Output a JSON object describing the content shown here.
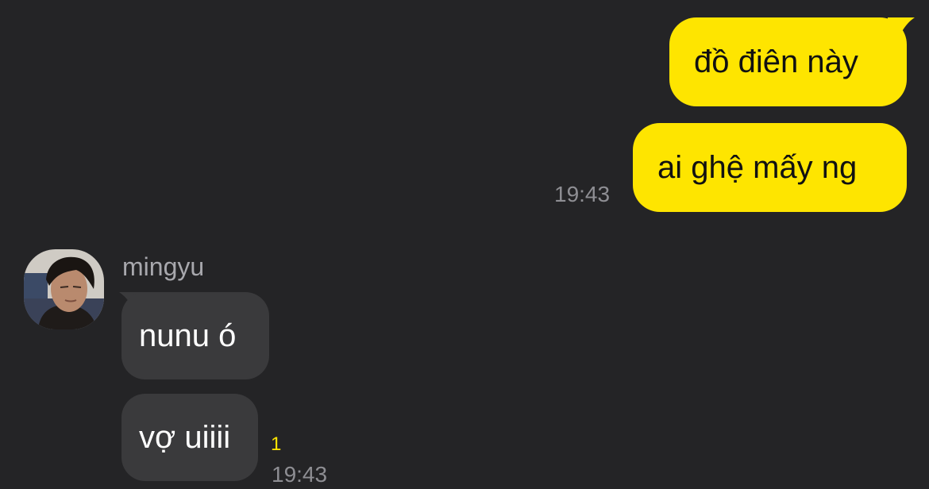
{
  "chat": {
    "outgoing": [
      {
        "text": "đồ điên này"
      },
      {
        "text": "ai ghệ mấy ng"
      }
    ],
    "outgoing_time": "19:43",
    "incoming": {
      "sender": "mingyu",
      "messages": [
        {
          "text": "nunu ó"
        },
        {
          "text": "vợ uiiii"
        }
      ],
      "unread_count": "1",
      "time": "19:43"
    }
  },
  "colors": {
    "background": "#242426",
    "outgoing_bubble": "#fee500",
    "incoming_bubble": "#3a3a3c",
    "timestamp": "#8e8e93",
    "unread_badge": "#fee500"
  }
}
